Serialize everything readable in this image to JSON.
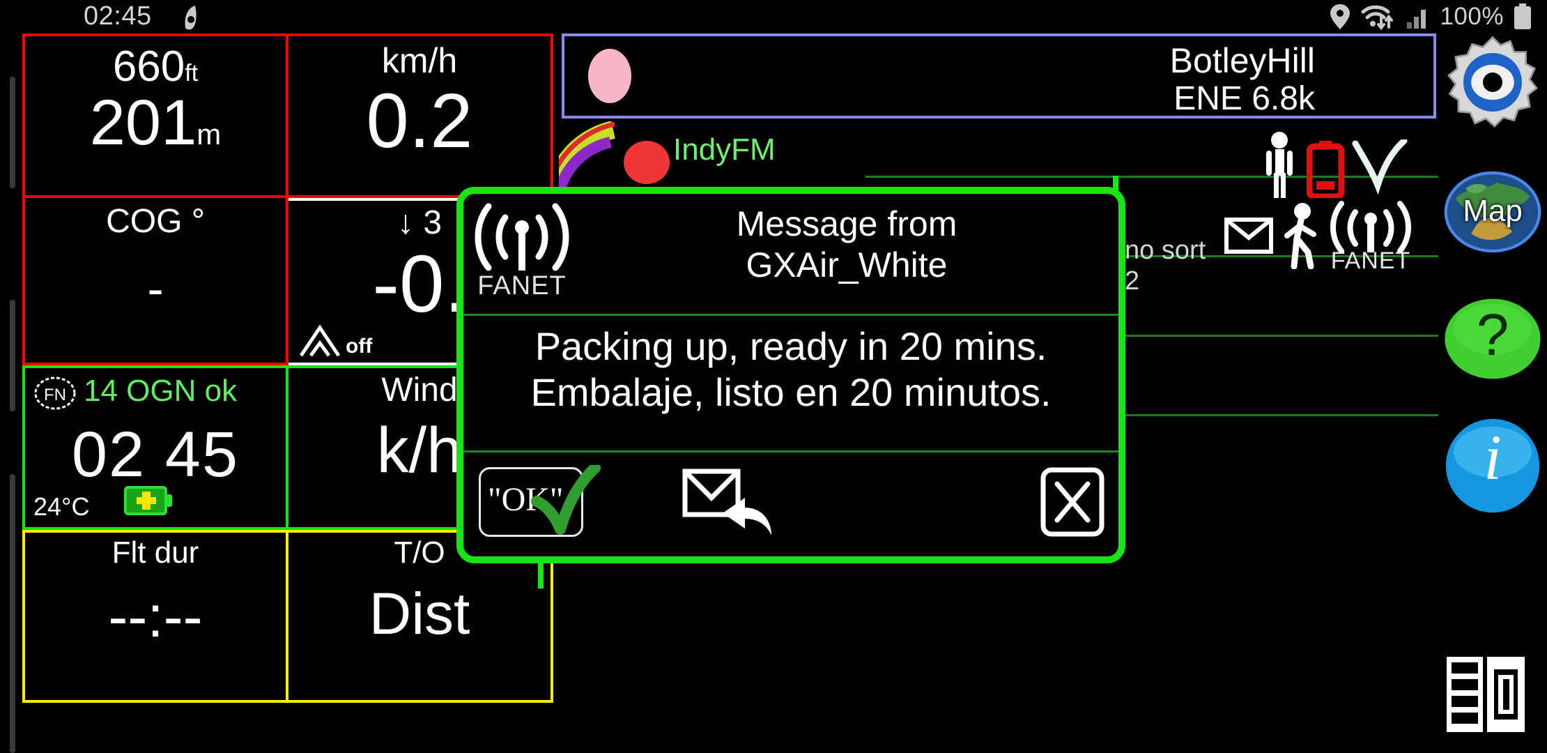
{
  "status_bar": {
    "clock": "02:45",
    "alarm_icon": "alarm-icon",
    "location_icon": "location-pin-icon",
    "wifi_icon": "wifi-icon",
    "signal_icon": "cellular-signal-icon",
    "battery_percent": "100%",
    "battery_icon": "battery-full-icon"
  },
  "instruments": {
    "altitude": {
      "feet_value": "660",
      "feet_unit": "ft",
      "meters_value": "201",
      "meters_unit": "m",
      "border_color": "#ff0000"
    },
    "speed": {
      "label": "km/h",
      "value": "0.2",
      "border_color": "#ff0000"
    },
    "cog": {
      "label": "COG °",
      "value": "-",
      "border_color": "#ff0000"
    },
    "vario": {
      "header_arrow": "↓",
      "header_value": "3",
      "value": "-0.",
      "footer_icon": "vario-peak-icon",
      "footer_text": "off",
      "border_color": "#ffffff"
    },
    "ogn": {
      "fanet_badge": "FN",
      "status": "14 OGN ok",
      "status_color": "#5ef05e",
      "clock": "02 45",
      "temperature": "24°C",
      "battery_icon": "external-battery-icon",
      "border_color": "#13e413"
    },
    "wind": {
      "label": "Wind",
      "value": "k/h",
      "border_color": "#13e413"
    },
    "flight_duration": {
      "label": "Flt dur",
      "value": "--:--",
      "border_color": "#ffee00"
    },
    "takeoff": {
      "label": "T/O",
      "value": "Dist",
      "border_color": "#ffee00"
    }
  },
  "map": {
    "waypoint_banner": {
      "marker_icon": "waypoint-dot-icon",
      "name": "BotleyHill",
      "bearing_distance": "ENE  6.8k",
      "border_color": "#8a8ae8"
    },
    "target_label": "IndyFM",
    "target_label_color": "#6ef06e",
    "sort_mode": "no sort",
    "sort_count": "2",
    "icons": {
      "standing_person": "person-standing-icon",
      "low_battery": "battery-low-red-icon",
      "check_mark": "checkmark-icon",
      "envelope": "envelope-icon",
      "walking_person": "person-walking-icon",
      "fanet_antenna": "fanet-antenna-icon",
      "fanet_label": "FANET"
    }
  },
  "toolbar": {
    "settings": {
      "name": "settings-gear-icon",
      "label": ""
    },
    "map": {
      "name": "map-globe-icon",
      "label": "Map"
    },
    "help": {
      "name": "help-question-icon",
      "label": "?"
    },
    "info": {
      "name": "info-icon",
      "label": "i"
    },
    "list": {
      "name": "list-zero-icon",
      "label": "0"
    }
  },
  "dialog": {
    "fanet_icon": "fanet-antenna-icon",
    "fanet_label": "FANET",
    "title_line1": "Message from",
    "title_line2": "GXAir_White",
    "body_line1": "Packing up, ready in 20 mins.",
    "body_line2": "Embalaje, listo en 20 minutos.",
    "ok_button_label": "\"OK\"",
    "ok_check_icon": "green-check-icon",
    "reply_button_icon": "reply-envelope-icon",
    "close_button_icon": "close-x-icon",
    "border_color": "#16e616"
  }
}
